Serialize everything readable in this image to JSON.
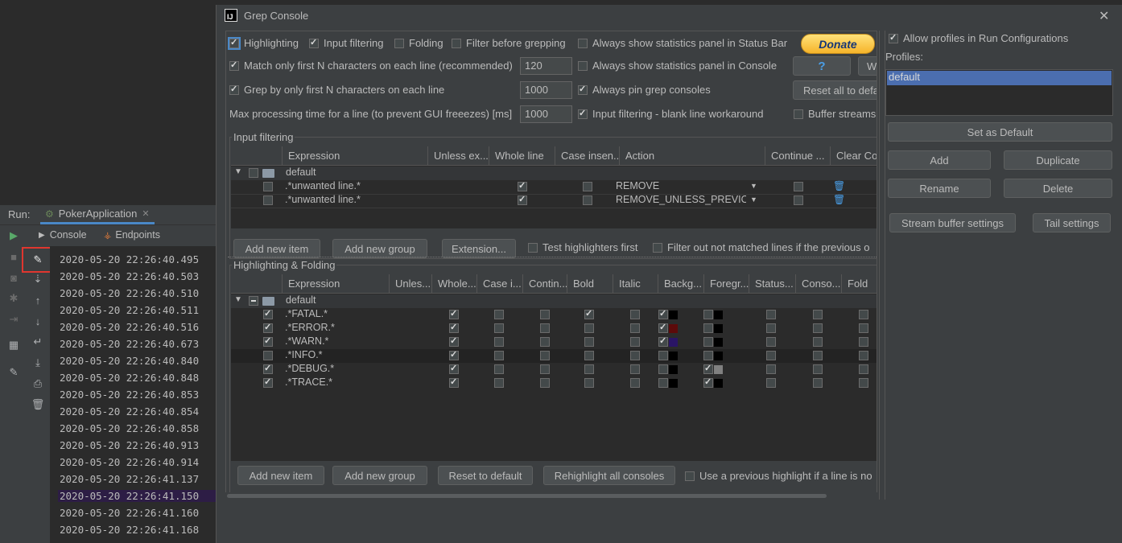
{
  "run": {
    "label": "Run:",
    "app_tab": "PokerApplication",
    "console_tab": "Console",
    "endpoints_tab": "Endpoints"
  },
  "console_lines": [
    "2020-05-20 22:26:40.495",
    "2020-05-20 22:26:40.503",
    "2020-05-20 22:26:40.510",
    "2020-05-20 22:26:40.511",
    "2020-05-20 22:26:40.516",
    "2020-05-20 22:26:40.673",
    "2020-05-20 22:26:40.840",
    "2020-05-20 22:26:40.848",
    "2020-05-20 22:26:40.853",
    "2020-05-20 22:26:40.854",
    "2020-05-20 22:26:40.858",
    "2020-05-20 22:26:40.913",
    "2020-05-20 22:26:40.914",
    "2020-05-20 22:26:41.137",
    "2020-05-20 22:26:41.150",
    "2020-05-20 22:26:41.160",
    "2020-05-20 22:26:41.168"
  ],
  "dialog": {
    "title": "Grep Console",
    "logo_text": "IJ",
    "close": "✕"
  },
  "options": {
    "highlighting": {
      "label": "Highlighting",
      "checked": true
    },
    "input_filtering": {
      "label": "Input filtering",
      "checked": true
    },
    "folding": {
      "label": "Folding",
      "checked": false
    },
    "filter_before": {
      "label": "Filter before grepping",
      "checked": false
    },
    "stats_status": {
      "label": "Always show statistics panel in Status Bar",
      "checked": false
    },
    "match_first_n": {
      "label": "Match only first N characters on each line (recommended)",
      "checked": true,
      "value": "120"
    },
    "stats_console": {
      "label": "Always show statistics panel in Console",
      "checked": false
    },
    "grep_first_n": {
      "label": "Grep by only first N characters on each line",
      "checked": true,
      "value": "1000"
    },
    "pin_consoles": {
      "label": "Always pin grep consoles",
      "checked": true
    },
    "max_time": {
      "label": "Max processing time for a line (to prevent GUI freeezes) [ms]",
      "value": "1000"
    },
    "blank_line": {
      "label": "Input filtering - blank line workaround",
      "checked": true
    },
    "buffer_streams": {
      "label": "Buffer streams",
      "checked": false
    }
  },
  "buttons": {
    "donate": "Donate",
    "help": "?",
    "w": "W",
    "reset_all": "Reset all to defa",
    "add_new_item": "Add new item",
    "add_new_group": "Add new group",
    "extension": "Extension...",
    "reset_default": "Reset to default",
    "rehighlight": "Rehighlight all consoles",
    "set_default": "Set as Default",
    "add": "Add",
    "duplicate": "Duplicate",
    "rename": "Rename",
    "delete": "Delete",
    "stream_buffer": "Stream buffer settings",
    "tail": "Tail settings"
  },
  "input_filtering": {
    "title": "Input filtering",
    "headers": [
      "Expression",
      "Unless ex...",
      "Whole line",
      "Case insen...",
      "Action",
      "Continue ...",
      "Clear Co"
    ],
    "group_name": "default",
    "rows": [
      {
        "expression": ".*unwanted line.*",
        "whole_line": true,
        "case_insensitive": false,
        "action": "REMOVE",
        "continue": false
      },
      {
        "expression": ".*unwanted line.*",
        "whole_line": true,
        "case_insensitive": false,
        "action": "REMOVE_UNLESS_PREVIO...",
        "continue": false
      }
    ],
    "test_highlighters": {
      "label": "Test highlighters first",
      "checked": false
    },
    "filter_out": {
      "label": "Filter out not matched lines if the previous o",
      "checked": false
    }
  },
  "highlighting": {
    "title": "Highlighting & Folding",
    "headers": [
      "Expression",
      "Unles...",
      "Whole...",
      "Case i...",
      "Contin...",
      "Bold",
      "Italic",
      "Backg...",
      "Foregr...",
      "Status...",
      "Conso...",
      "Fold"
    ],
    "group_name": "default",
    "rows": [
      {
        "expression": ".*FATAL.*",
        "enabled": true,
        "unless": false,
        "whole": true,
        "case": false,
        "cont": false,
        "bold": true,
        "italic": false,
        "bg_on": true,
        "bg": "#000000",
        "fg_on": false,
        "fg": "#000000",
        "status": false,
        "console": false,
        "fold": false
      },
      {
        "expression": ".*ERROR.*",
        "enabled": true,
        "unless": false,
        "whole": true,
        "case": false,
        "cont": false,
        "bold": false,
        "italic": false,
        "bg_on": true,
        "bg": "#5c0a0a",
        "fg_on": false,
        "fg": "#000000",
        "status": false,
        "console": false,
        "fold": false
      },
      {
        "expression": ".*WARN.*",
        "enabled": true,
        "unless": false,
        "whole": true,
        "case": false,
        "cont": false,
        "bold": false,
        "italic": false,
        "bg_on": true,
        "bg": "#2a1566",
        "fg_on": false,
        "fg": "#000000",
        "status": false,
        "console": false,
        "fold": false
      },
      {
        "expression": ".*INFO.*",
        "enabled": false,
        "unless": false,
        "whole": true,
        "case": false,
        "cont": false,
        "bold": false,
        "italic": false,
        "bg_on": false,
        "bg": "#000000",
        "fg_on": false,
        "fg": "#000000",
        "status": false,
        "console": false,
        "fold": false
      },
      {
        "expression": ".*DEBUG.*",
        "enabled": true,
        "unless": false,
        "whole": true,
        "case": false,
        "cont": false,
        "bold": false,
        "italic": false,
        "bg_on": false,
        "bg": "#000000",
        "fg_on": true,
        "fg": "#808080",
        "status": false,
        "console": false,
        "fold": false
      },
      {
        "expression": ".*TRACE.*",
        "enabled": true,
        "unless": false,
        "whole": true,
        "case": false,
        "cont": false,
        "bold": false,
        "italic": false,
        "bg_on": false,
        "bg": "#000000",
        "fg_on": true,
        "fg": "#000000",
        "status": false,
        "console": false,
        "fold": false
      }
    ],
    "previous_highlight": {
      "label": "Use a previous highlight if a line is no",
      "checked": false
    }
  },
  "profiles": {
    "allow_label": "Allow profiles in Run Configurations",
    "allow_checked": true,
    "label": "Profiles:",
    "items": [
      "default"
    ]
  },
  "colors": {
    "accent": "#4b6eaf",
    "selected_row": "#2d1d45",
    "highlight_box": "#e0362f",
    "run_green": "#59a869"
  }
}
